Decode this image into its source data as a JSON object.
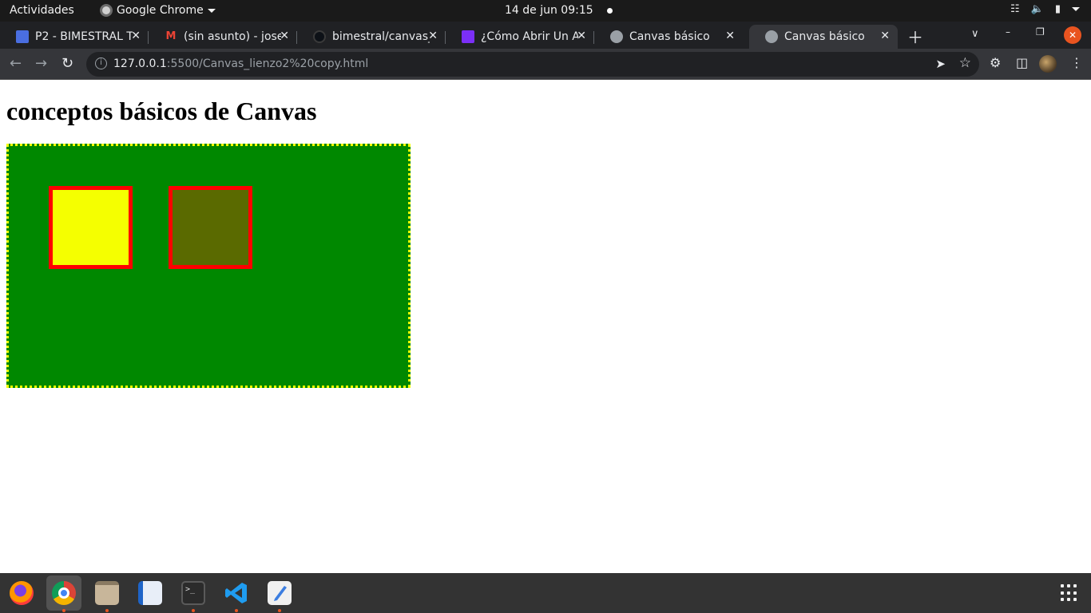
{
  "topbar": {
    "activities": "Actividades",
    "app_name": "Google Chrome",
    "clock": "14 de jun  09:15"
  },
  "tabs": [
    {
      "title": "P2 - BIMESTRAL TI",
      "favicon": "classroom-icon"
    },
    {
      "title": "(sin asunto) - jose",
      "favicon": "gmail-icon"
    },
    {
      "title": "bimestral/canvas_",
      "favicon": "github-icon"
    },
    {
      "title": "¿Cómo Abrir Un Ar",
      "favicon": "document-icon"
    },
    {
      "title": "Canvas básico",
      "favicon": "globe-icon"
    },
    {
      "title": "Canvas básico",
      "favicon": "globe-icon",
      "active": true
    }
  ],
  "address_bar": {
    "host": "127.0.0.1",
    "path": ":5500/Canvas_lienzo2%20copy.html"
  },
  "page": {
    "heading": "conceptos básicos de Canvas",
    "canvas": {
      "background": "#008800",
      "border_color": "#f5ff00",
      "squares": [
        {
          "fill": "#f5ff00",
          "stroke": "#ff0000"
        },
        {
          "fill": "#5a6a00",
          "stroke": "#ff0000"
        }
      ]
    }
  },
  "dock": {
    "apps": [
      "firefox-icon",
      "chrome-icon",
      "files-icon",
      "writer-icon",
      "terminal-icon",
      "vscode-icon",
      "text-editor-icon"
    ],
    "terminal_glyph": ">_"
  },
  "colors": {
    "accent": "#e95420",
    "chrome_dark": "#202124",
    "toolbar": "#35363a"
  }
}
